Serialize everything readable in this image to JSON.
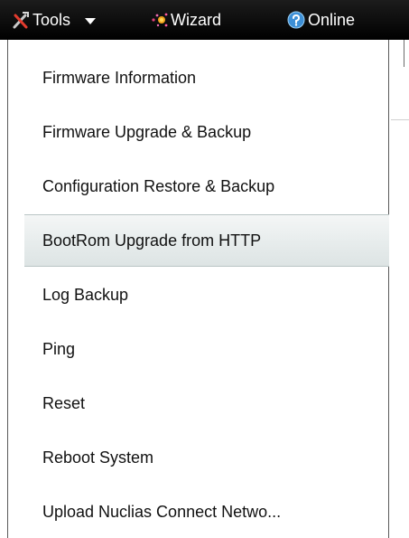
{
  "menubar": {
    "tools": {
      "label": "Tools",
      "icon": "tools-icon"
    },
    "wizard": {
      "label": "Wizard",
      "icon": "wizard-icon"
    },
    "online": {
      "label": "Online",
      "icon": "online-help-icon"
    }
  },
  "dropdown": {
    "items": [
      {
        "label": "Firmware Information"
      },
      {
        "label": "Firmware Upgrade & Backup"
      },
      {
        "label": "Configuration Restore & Backup"
      },
      {
        "label": "BootRom Upgrade from HTTP",
        "selected": true
      },
      {
        "label": "Log Backup"
      },
      {
        "label": "Ping"
      },
      {
        "label": "Reset"
      },
      {
        "label": "Reboot System"
      },
      {
        "label": "Upload Nuclias Connect Netwo..."
      }
    ]
  },
  "colors": {
    "menubar_bg": "#000000",
    "menubar_text": "#ffffff",
    "item_text": "#111111",
    "selected_bg": "#e8eded",
    "dropdown_border": "#5a5a5a"
  }
}
